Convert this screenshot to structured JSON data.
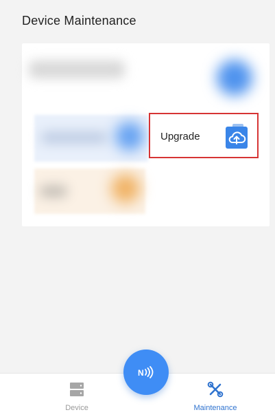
{
  "header": {
    "title": "Device Maintenance"
  },
  "card": {
    "upgrade": {
      "label": "Upgrade",
      "icon": "cloud-upload-icon"
    }
  },
  "nfc_button": {
    "icon": "nfc-icon"
  },
  "bottom_nav": {
    "tabs": [
      {
        "label": "Device",
        "icon": "device-icon",
        "active": false
      },
      {
        "label": "Maintenance",
        "icon": "maintenance-tools-icon",
        "active": true
      }
    ]
  },
  "colors": {
    "accent": "#3f8df5",
    "highlight_border": "#d63434",
    "active_tab": "#2f73cf",
    "inactive_tab": "#9a9a9a"
  }
}
